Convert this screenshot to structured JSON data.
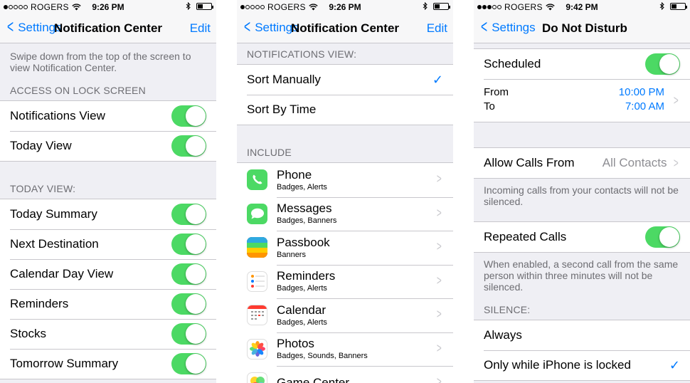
{
  "panel1": {
    "status": {
      "carrier": "ROGERS",
      "time": "9:26 PM"
    },
    "nav": {
      "back": "Settings",
      "title": "Notification Center",
      "edit": "Edit"
    },
    "intro": "Swipe down from the top of the screen to view Notification Center.",
    "lock_header": "ACCESS ON LOCK SCREEN",
    "lock_rows": [
      {
        "label": "Notifications View",
        "on": true
      },
      {
        "label": "Today View",
        "on": true
      }
    ],
    "today_header": "TODAY VIEW:",
    "today_rows": [
      {
        "label": "Today Summary",
        "on": true
      },
      {
        "label": "Next Destination",
        "on": true
      },
      {
        "label": "Calendar Day View",
        "on": true
      },
      {
        "label": "Reminders",
        "on": true
      },
      {
        "label": "Stocks",
        "on": true
      },
      {
        "label": "Tomorrow Summary",
        "on": true
      }
    ]
  },
  "panel2": {
    "status": {
      "carrier": "ROGERS",
      "time": "9:26 PM"
    },
    "nav": {
      "back": "Settings",
      "title": "Notification Center",
      "edit": "Edit"
    },
    "view_header": "NOTIFICATIONS VIEW:",
    "sort_options": [
      {
        "label": "Sort Manually",
        "selected": true
      },
      {
        "label": "Sort By Time",
        "selected": false
      }
    ],
    "include_header": "INCLUDE",
    "apps": [
      {
        "name": "Phone",
        "sub": "Badges, Alerts",
        "icon": "phone-app-icon"
      },
      {
        "name": "Messages",
        "sub": "Badges, Banners",
        "icon": "messages-app-icon"
      },
      {
        "name": "Passbook",
        "sub": "Banners",
        "icon": "passbook-app-icon"
      },
      {
        "name": "Reminders",
        "sub": "Badges, Alerts",
        "icon": "reminders-app-icon"
      },
      {
        "name": "Calendar",
        "sub": "Badges, Alerts",
        "icon": "calendar-app-icon"
      },
      {
        "name": "Photos",
        "sub": "Badges, Sounds, Banners",
        "icon": "photos-app-icon"
      },
      {
        "name": "Game Center",
        "sub": "",
        "icon": "game-center-app-icon"
      }
    ]
  },
  "panel3": {
    "status": {
      "carrier": "ROGERS",
      "time": "9:42 PM"
    },
    "nav": {
      "back": "Settings",
      "title": "Do Not Disturb"
    },
    "scheduled": {
      "label": "Scheduled",
      "on": true
    },
    "schedule": {
      "from_label": "From",
      "to_label": "To",
      "from_time": "10:00 PM",
      "to_time": "7:00 AM"
    },
    "allow_calls": {
      "label": "Allow Calls From",
      "value": "All Contacts"
    },
    "allow_calls_footer": "Incoming calls from your contacts will not be silenced.",
    "repeated": {
      "label": "Repeated Calls",
      "on": true
    },
    "repeated_footer": "When enabled, a second call from the same person within three minutes will not be silenced.",
    "silence_header": "SILENCE:",
    "silence_options": [
      {
        "label": "Always",
        "selected": false
      },
      {
        "label": "Only while iPhone is locked",
        "selected": true
      }
    ]
  },
  "colors": {
    "accent": "#007aff",
    "toggle_on": "#4cd964",
    "background": "#efeff4",
    "separator": "#c8c7cc"
  }
}
